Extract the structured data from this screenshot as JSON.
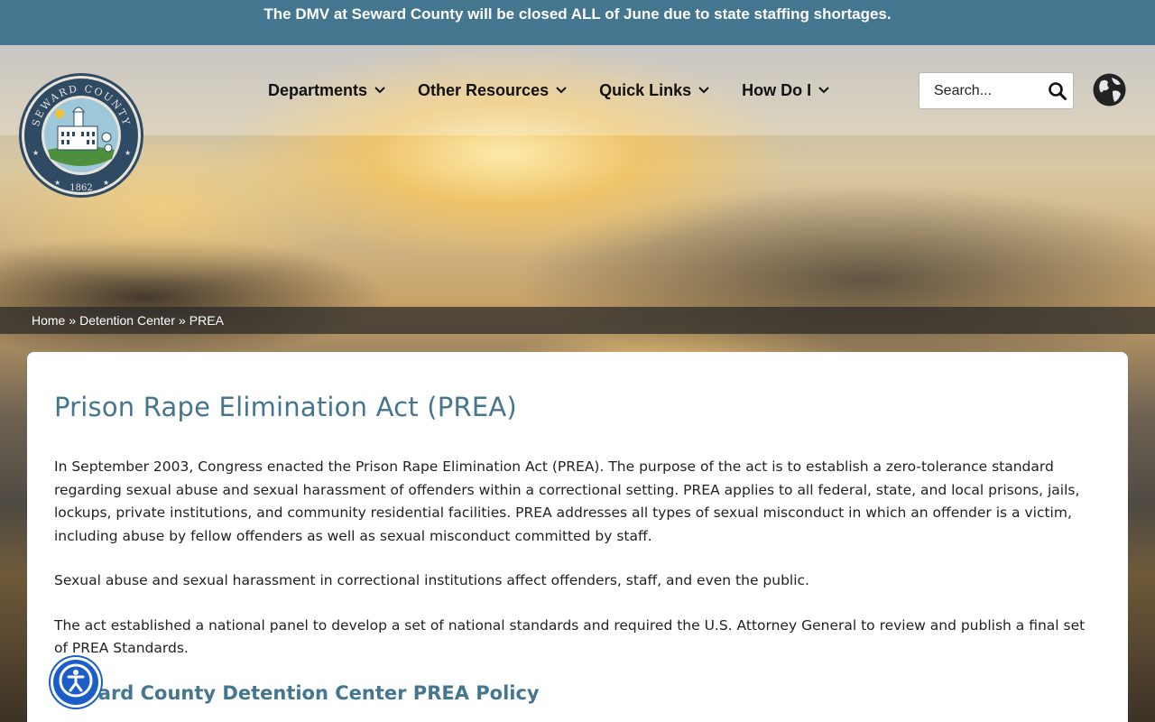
{
  "announcement": {
    "text": "The DMV at Seward County will be closed ALL of June due to state staffing shortages."
  },
  "logo": {
    "top_text": "SEWARD COUNTY",
    "year": "1862"
  },
  "nav": {
    "items": [
      {
        "label": "Departments",
        "icon": "chevron-down-icon"
      },
      {
        "label": "Other Resources",
        "icon": "chevron-down-icon"
      },
      {
        "label": "Quick Links",
        "icon": "chevron-down-icon"
      },
      {
        "label": "How Do I",
        "icon": "chevron-down-icon"
      }
    ]
  },
  "search": {
    "placeholder": "Search...",
    "icon": "search-icon"
  },
  "globe": {
    "icon": "globe-icon"
  },
  "breadcrumb": {
    "items": [
      "Home",
      "Detention Center",
      "PREA"
    ],
    "separator": "»"
  },
  "main": {
    "title": "Prison Rape Elimination Act (PREA)",
    "paragraphs": [
      "In September 2003, Congress enacted the Prison Rape Elimination Act (PREA). The purpose of the act is to establish a zero-tolerance standard regarding sexual abuse and sexual harassment of offenders within a correctional setting. PREA applies to all federal, state, and local prisons, jails, lockups, private institutions, and community residential facilities. PREA addresses all types of sexual misconduct in which an offender is a victim, including abuse by fellow offenders as well as sexual misconduct committed by staff.",
      "Sexual abuse and sexual harassment in correctional institutions affect offenders, staff, and even the public.",
      "The act established a national panel to develop a set of national standards and required the U.S. Attorney General to review and publish a final set of PREA Standards."
    ],
    "subheading": "Seward County Detention Center PREA Policy"
  },
  "accessibility": {
    "icon": "accessibility-icon"
  },
  "colors": {
    "accent": "#447690",
    "announcement_bg": "#447690",
    "a11y_blue": "#1c5ec7"
  }
}
